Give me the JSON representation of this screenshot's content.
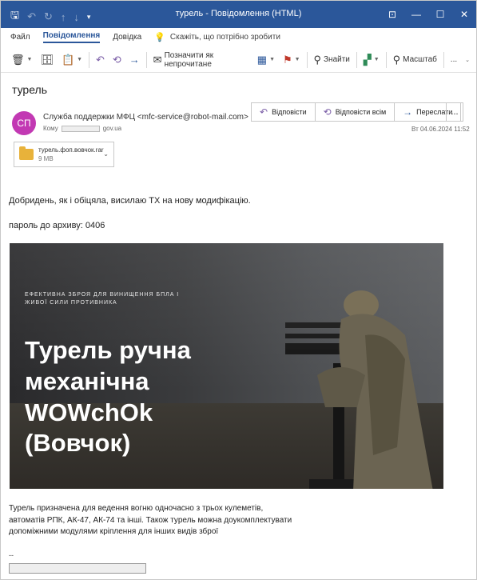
{
  "window": {
    "title": "турель  -  Повідомлення (HTML)"
  },
  "ribbon": {
    "tabs": [
      "Файл",
      "Повідомлення",
      "Довідка"
    ],
    "tell_me": "Скажіть, що потрібно зробити"
  },
  "toolbar": {
    "mark_unread": "Позначити як непрочитане",
    "find": "Знайти",
    "zoom": "Масштаб",
    "more": "..."
  },
  "message": {
    "subject": "турель",
    "avatar_initials": "СП",
    "avatar_color": "#c239b3",
    "sender": "Служба поддержки МФЦ <mfc-service@robot-mail.com>",
    "to_label": "Кому",
    "to_domain": "gov.ua",
    "datetime": "Вт 04.06.2024 11:52",
    "actions": {
      "reply": "Відповісти",
      "reply_all": "Відповісти всім",
      "forward": "Переслати"
    },
    "attachment": {
      "name": "турель.фоп.вовчок.rar",
      "size": "9 МВ"
    },
    "body": {
      "greeting": "Добридень, як і обіцяла, висилаю ТХ на нову модифікацію.",
      "password": "пароль до архиву: 0406",
      "banner_tagline": "ЕФЕКТИВНА ЗБРОЯ ДЛЯ ВИНИЩЕННЯ БПЛА І ЖИВОЇ СИЛИ ПРОТИВНИКА",
      "banner_headline_lines": [
        "Турель ручна",
        "механічна",
        "WOWchOk",
        "(Вовчок)"
      ],
      "caption_lines": [
        "Турель призначена для ведення вогню одночасно з трьох кулеметів,",
        "автоматів РПК, АК-47, АК-74 та інші. Також турель можна доукомплектувати",
        "допоміжними модулями кріплення для інших видів зброї"
      ],
      "signature_dash": "--"
    }
  }
}
